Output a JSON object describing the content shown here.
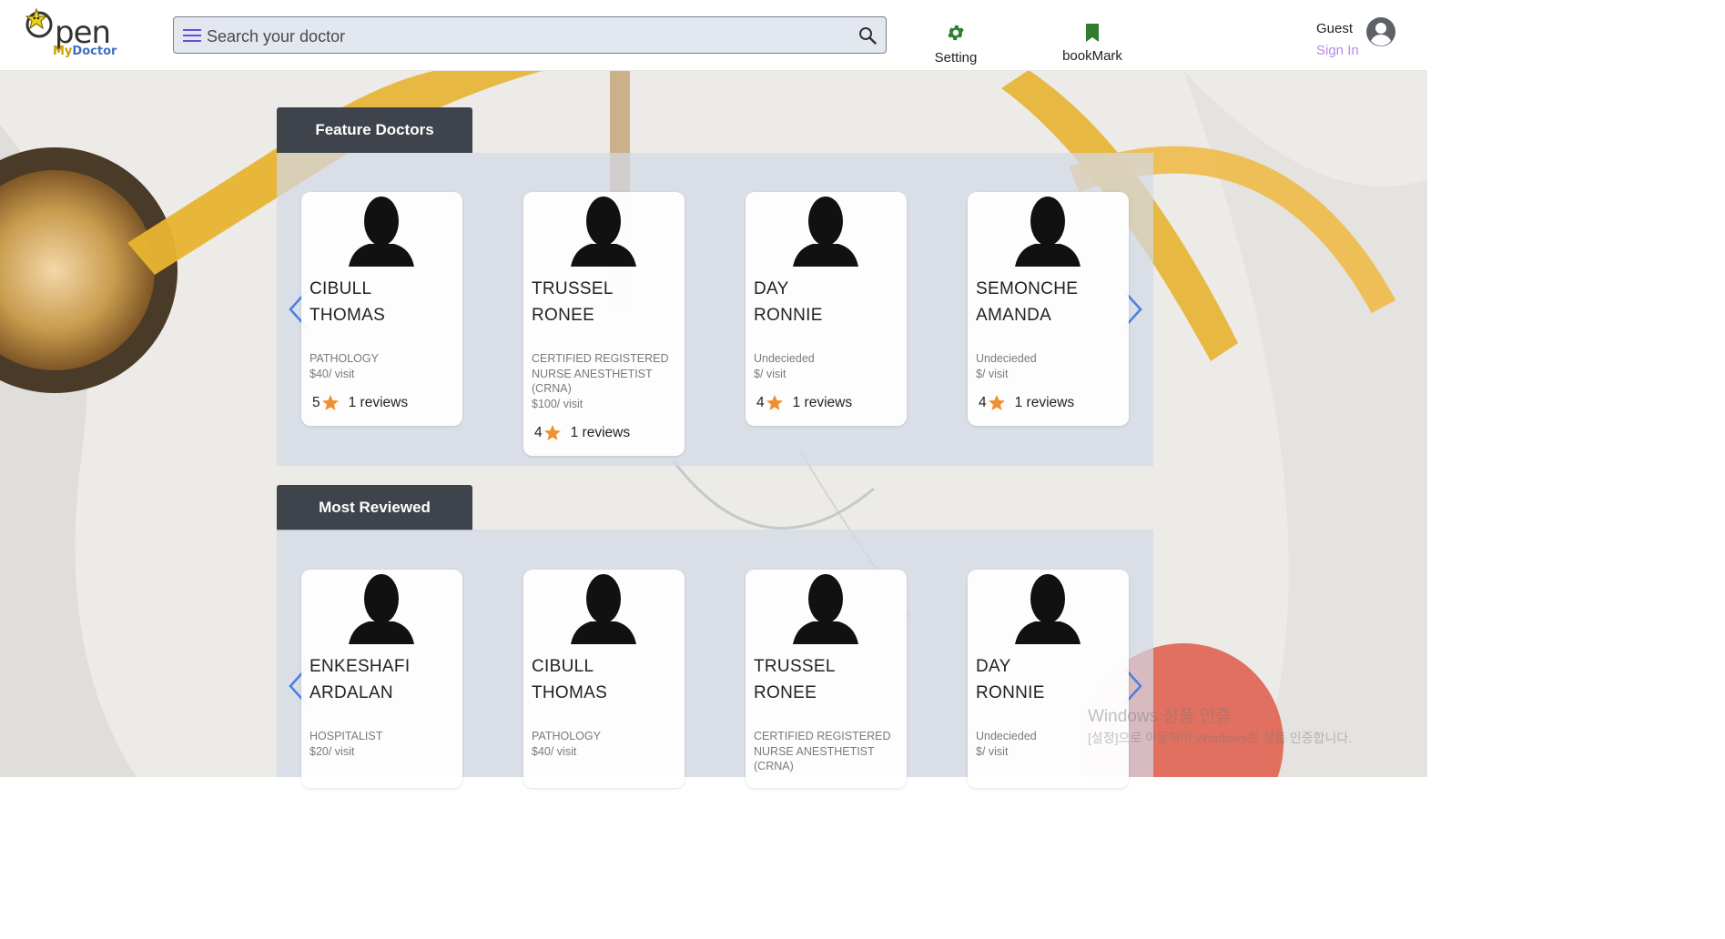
{
  "header": {
    "logo": {
      "word": "pen",
      "sub_my": "My",
      "sub_doctor": "Doctor"
    },
    "search": {
      "placeholder": "Search your doctor"
    },
    "nav": {
      "setting": "Setting",
      "bookmark": "bookMark"
    },
    "user": {
      "name": "Guest",
      "signin": "Sign In"
    }
  },
  "colors": {
    "accent_purple": "#b48be0",
    "setting_icon": "#2e7d32",
    "bookmark_icon": "#2e7d32",
    "star": "#f0902e",
    "section_tab": "#3f434b",
    "arrow": "#4a7fe0"
  },
  "sections": [
    {
      "title": "Feature Doctors",
      "cards": [
        {
          "first": "CIBULL",
          "last": "THOMAS",
          "specialty": "PATHOLOGY",
          "price": "$40/ visit",
          "rating": "5",
          "reviews": "1 reviews"
        },
        {
          "first": "TRUSSEL",
          "last": "RONEE",
          "specialty": "CERTIFIED REGISTERED NURSE ANESTHETIST (CRNA)",
          "price": "$100/ visit",
          "rating": "4",
          "reviews": "1 reviews"
        },
        {
          "first": "DAY",
          "last": "RONNIE",
          "specialty": "Undecieded",
          "price": "$/ visit",
          "rating": "4",
          "reviews": "1 reviews"
        },
        {
          "first": "SEMONCHE",
          "last": "AMANDA",
          "specialty": "Undecieded",
          "price": "$/ visit",
          "rating": "4",
          "reviews": "1 reviews"
        }
      ]
    },
    {
      "title": "Most Reviewed",
      "cards": [
        {
          "first": "ENKESHAFI",
          "last": "ARDALAN",
          "specialty": "HOSPITALIST",
          "price": "$20/ visit",
          "rating": "",
          "reviews": ""
        },
        {
          "first": "CIBULL",
          "last": "THOMAS",
          "specialty": "PATHOLOGY",
          "price": "$40/ visit",
          "rating": "",
          "reviews": ""
        },
        {
          "first": "TRUSSEL",
          "last": "RONEE",
          "specialty": "CERTIFIED REGISTERED NURSE ANESTHETIST (CRNA)",
          "price": "",
          "rating": "",
          "reviews": ""
        },
        {
          "first": "DAY",
          "last": "RONNIE",
          "specialty": "Undecieded",
          "price": "$/ visit",
          "rating": "",
          "reviews": ""
        }
      ]
    }
  ],
  "icons": {
    "menu": "hamburger-icon",
    "search": "magnifier-icon",
    "setting": "gear-icon",
    "bookmark": "bookmark-icon",
    "user": "user-circle-icon",
    "doctor_photo": "person-silhouette-icon",
    "star": "star-icon",
    "prev": "chevron-left-icon",
    "next": "chevron-right-icon"
  },
  "watermark": {
    "line1": "Windows 정품 인증",
    "line2": "[설정]으로 이동하여 Windows를 정품 인증합니다."
  }
}
